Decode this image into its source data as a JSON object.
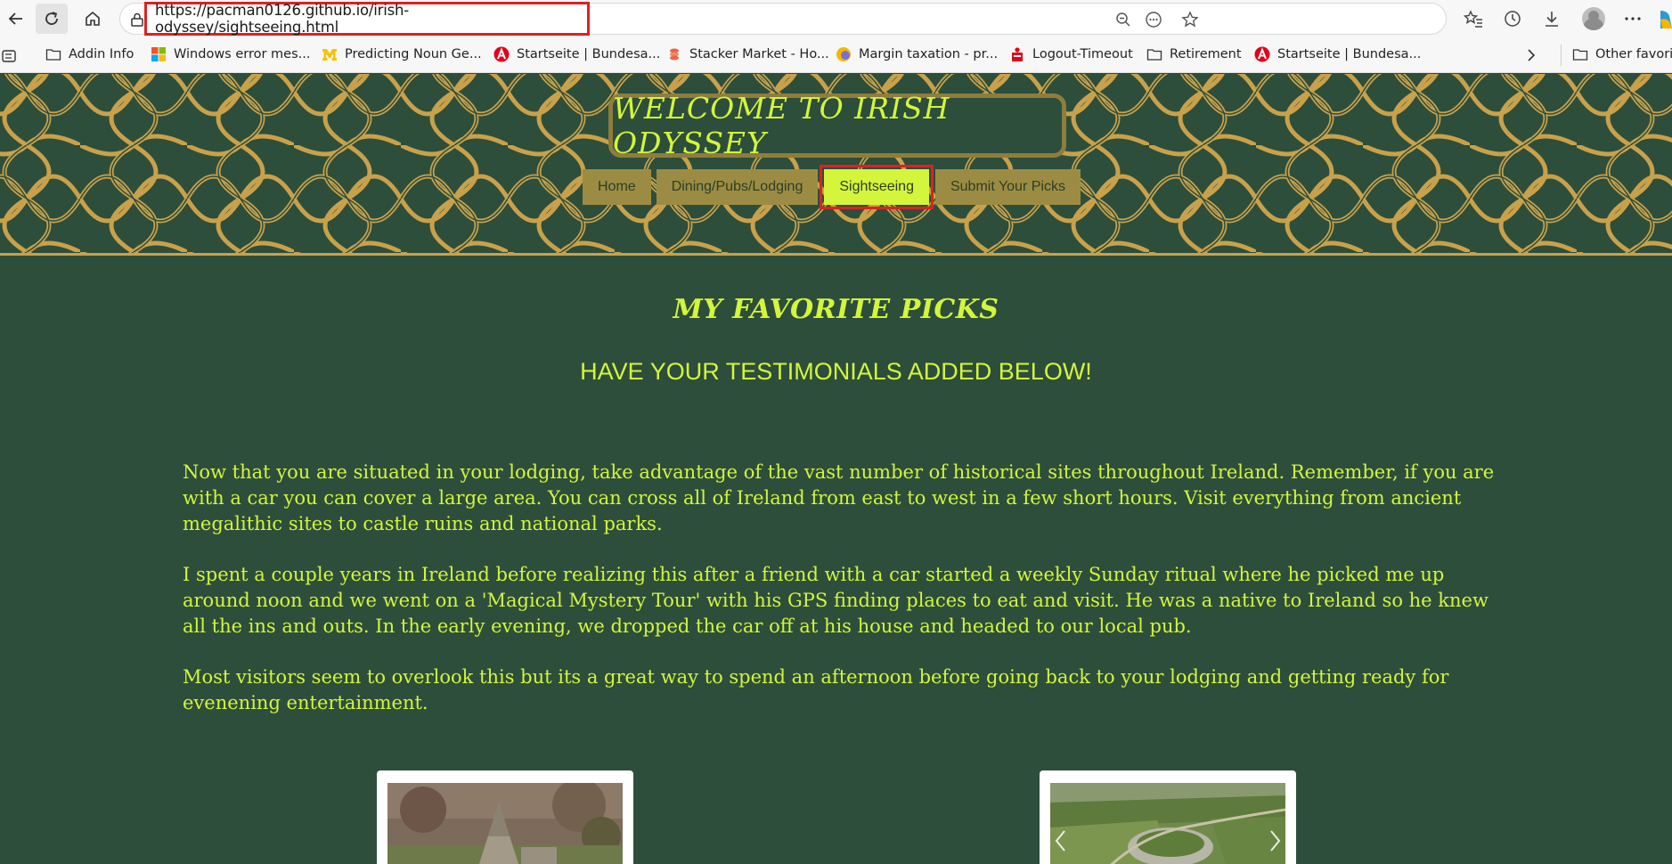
{
  "browser": {
    "url": "https://pacman0126.github.io/irish-odyssey/sightseeing.html",
    "bookmarks": [
      {
        "label": "Addin Info",
        "icon": "folder-icon"
      },
      {
        "label": "Windows error mes...",
        "icon": "windows-logo-icon"
      },
      {
        "label": "Predicting Noun Ge...",
        "icon": "michigan-logo-icon"
      },
      {
        "label": "Startseite | Bundesa...",
        "icon": "arbeitsagentur-logo-icon"
      },
      {
        "label": "Stacker Market - Ho...",
        "icon": "stacker-logo-icon"
      },
      {
        "label": "Margin taxation - pr...",
        "icon": "circle-logo-icon"
      },
      {
        "label": "Logout-Timeout",
        "icon": "sparkasse-logo-icon"
      },
      {
        "label": "Retirement",
        "icon": "folder-icon"
      },
      {
        "label": "Startseite | Bundesa...",
        "icon": "arbeitsagentur-logo-icon"
      },
      {
        "label": "Other favorit",
        "icon": "folder-icon"
      }
    ]
  },
  "site": {
    "title": "WELCOME TO IRISH ODYSSEY",
    "nav": {
      "home": "Home",
      "dining": "Dining/Pubs/Lodging",
      "sightseeing": "Sightseeing",
      "submit": "Submit Your Picks"
    }
  },
  "main": {
    "heading": "MY FAVORITE PICKS",
    "subheading": "HAVE YOUR TESTIMONIALS ADDED BELOW!",
    "paragraphs": [
      "Now that you are situated in your lodging, take advantage of the vast number of historical sites throughout Ireland. Remember, if you are with a car you can cover a large area. You can cross all of Ireland from east to west in a few short hours. Visit everything from ancient megalithic sites to castle ruins and national parks.",
      "I spent a couple years in Ireland before realizing this after a friend with a car started a weekly Sunday ritual where he picked me up around noon and we went on a 'Magical Mystery Tour' with his GPS finding places to eat and visit. He was a native to Ireland so he knew all the ins and outs. In the early evening, we dropped the car off at his house and headed to our local pub.",
      "Most visitors seem to overlook this but its a great way to spend an afternoon before going back to your lodging and getting ready for evenening entertainment."
    ]
  },
  "colors": {
    "background": "#2d4e3b",
    "accent": "#d4f53c",
    "gold": "#c9a14a",
    "nav_button": "#9c8c43",
    "highlight": "#e02020"
  }
}
